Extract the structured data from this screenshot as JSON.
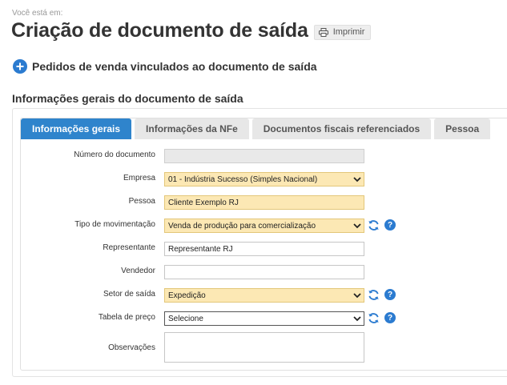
{
  "breadcrumb": "Você está em:",
  "page_title": "Criação de documento de saída",
  "print_label": "Imprimir",
  "linked_orders": {
    "label": "Pedidos de venda vinculados ao documento de saída"
  },
  "general_section": {
    "title": "Informações gerais do documento de saída"
  },
  "tabs": [
    {
      "label": "Informações gerais",
      "active": true
    },
    {
      "label": "Informações da NFe"
    },
    {
      "label": "Documentos fiscais referenciados"
    },
    {
      "label": "Pessoa"
    }
  ],
  "form": {
    "numero_documento": {
      "label": "Número do documento",
      "value": ""
    },
    "empresa": {
      "label": "Empresa",
      "value": "01 - Indústria Sucesso (Simples Nacional)"
    },
    "pessoa": {
      "label": "Pessoa",
      "value": "Cliente Exemplo RJ"
    },
    "tipo_movimentacao": {
      "label": "Tipo de movimentação",
      "value": "Venda de produção para comercialização"
    },
    "representante": {
      "label": "Representante",
      "value": "Representante RJ"
    },
    "vendedor": {
      "label": "Vendedor",
      "value": ""
    },
    "setor_saida": {
      "label": "Setor de saída",
      "value": "Expedição"
    },
    "tabela_preco": {
      "label": "Tabela de preço",
      "value": "Selecione"
    },
    "observacoes": {
      "label": "Observações",
      "value": ""
    }
  },
  "icons": {
    "plus": "plus-circle-icon",
    "print": "printer-icon",
    "refresh": "refresh-icon",
    "help": "question-mark-icon",
    "dropdown": "chevron-down-icon"
  },
  "help_glyph": "?",
  "colors": {
    "accent": "#2f84cc",
    "required_field": "#fce8b4",
    "disabled_field": "#e9e9e9",
    "inactive_tab": "#e7e7e7"
  }
}
